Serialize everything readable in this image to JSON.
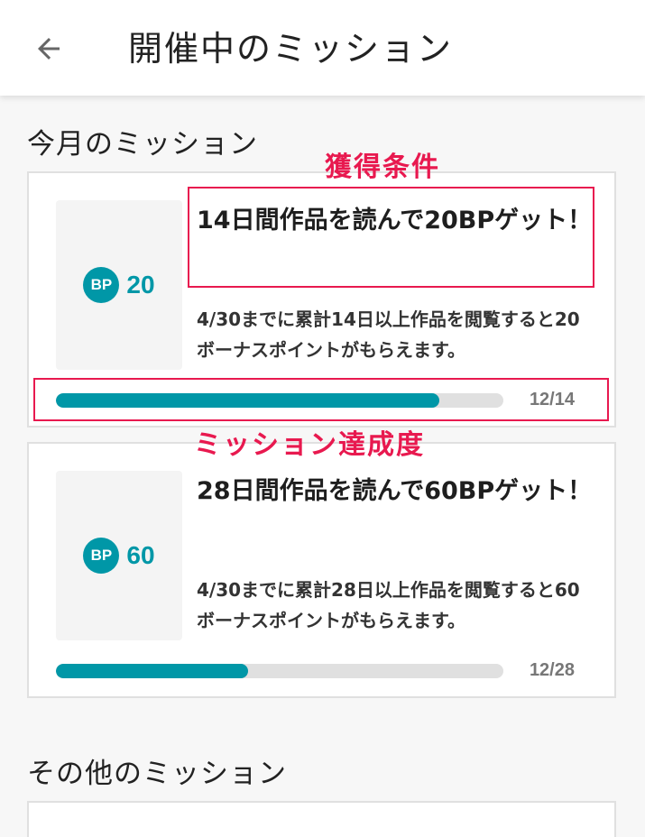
{
  "header": {
    "title": "開催中のミッション"
  },
  "sections": {
    "this_month": "今月のミッション",
    "other": "その他のミッション"
  },
  "missions": [
    {
      "badge": "BP",
      "points": "20",
      "title": "14日間作品を読んで20BPゲット！",
      "description": "4/30までに累計14日以上作品を閲覧すると20ボーナスポイントがもらえます。",
      "progress_label": "12/14",
      "progress_fraction": 0.857
    },
    {
      "badge": "BP",
      "points": "60",
      "title": "28日間作品を読んで60BPゲット！",
      "description": "4/30までに累計28日以上作品を閲覧すると60ボーナスポイントがもらえます。",
      "progress_label": "12/28",
      "progress_fraction": 0.429
    }
  ],
  "annotations": {
    "condition_label": "獲得条件",
    "progress_label": "ミッション達成度"
  },
  "colors": {
    "accent": "#0097a7",
    "annotation": "#e8194f",
    "track": "#e0e0e0"
  },
  "icons": {
    "back": "arrow-back-icon"
  }
}
